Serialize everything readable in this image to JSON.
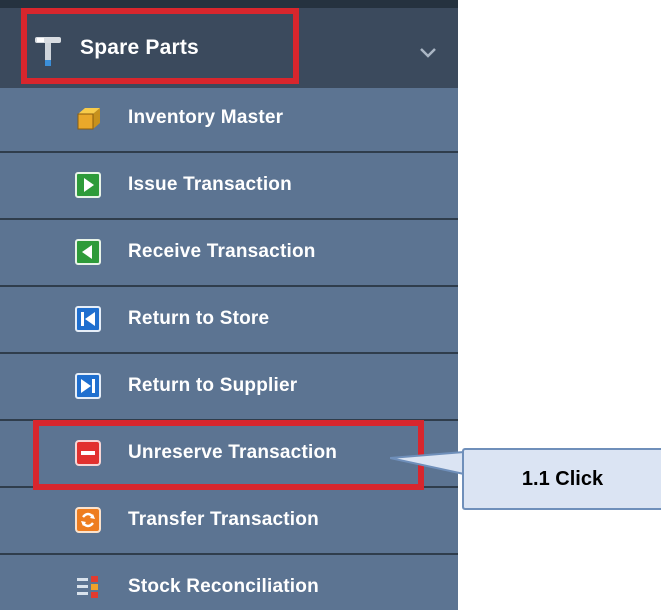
{
  "menu": {
    "header": {
      "label": "Spare Parts",
      "icon": "hammer-icon"
    },
    "items": [
      {
        "label": "Inventory Master",
        "icon": "box-icon"
      },
      {
        "label": "Issue Transaction",
        "icon": "play-right-icon"
      },
      {
        "label": "Receive Transaction",
        "icon": "play-left-icon"
      },
      {
        "label": "Return to Store",
        "icon": "skip-back-icon"
      },
      {
        "label": "Return to Supplier",
        "icon": "skip-forward-icon"
      },
      {
        "label": "Unreserve Transaction",
        "icon": "minus-icon"
      },
      {
        "label": "Transfer Transaction",
        "icon": "transfer-icon"
      },
      {
        "label": "Stock Reconciliation",
        "icon": "reconcile-icon"
      }
    ]
  },
  "callout": {
    "text": "1.1 Click"
  },
  "colors": {
    "highlight": "#d8262d",
    "menu_bg": "#5c7492",
    "header_bg": "#3b4a5d",
    "callout_bg": "#dbe4f3"
  }
}
